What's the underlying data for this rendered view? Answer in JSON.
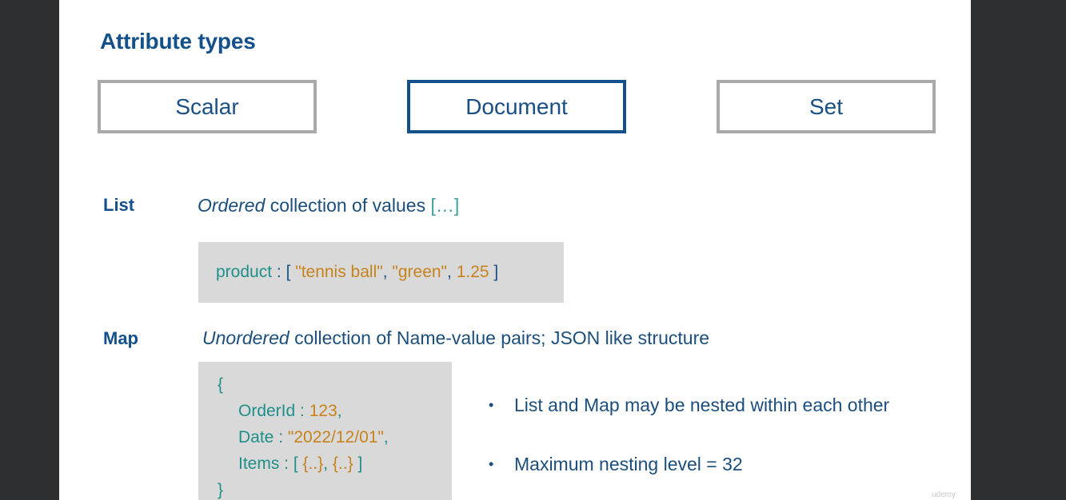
{
  "slide": {
    "title": "Attribute types",
    "types": [
      {
        "label": "Scalar",
        "selected": false
      },
      {
        "label": "Document",
        "selected": true
      },
      {
        "label": "Set",
        "selected": false
      }
    ],
    "list": {
      "label": "List",
      "desc_em": "Ordered",
      "desc_rest": " collection of values ",
      "desc_bracket": "[…]",
      "code": {
        "key": "product",
        "sep": " : ",
        "open": "[ ",
        "v1": "\"tennis ball\"",
        "c1": ", ",
        "v2": "\"green\"",
        "c2": ", ",
        "v3": "1.25",
        "close": " ]"
      }
    },
    "map": {
      "label": "Map",
      "desc_em": "Unordered",
      "desc_rest": " collection of Name-value  pairs; JSON like structure",
      "code": {
        "open_brace": "{",
        "k1": "OrderId",
        "s1": " : ",
        "v1": "123",
        "c1": ",",
        "k2": "Date",
        "s2": " : ",
        "v2": "\"2022/12/01\"",
        "c2": ",",
        "k3": "Items",
        "s3": " : ",
        "v3_open": "[ ",
        "v3a": "{..}",
        "v3_comma": ", ",
        "v3b": "{..}",
        "v3_close": " ]",
        "close_brace": "}"
      }
    },
    "bullets": [
      "List and Map may be nested within each other",
      "Maximum nesting level = 32"
    ],
    "bullet_glyph": "•",
    "watermark": "udemy"
  },
  "colors": {
    "title_blue": "#14508a",
    "text_blue": "#1b4e7c",
    "teal": "#1f8f8a",
    "orange": "#c8821c",
    "box_gray": "#a9a9a9",
    "code_bg": "#d9d9d9",
    "frame_dark": "#2d2f31"
  }
}
